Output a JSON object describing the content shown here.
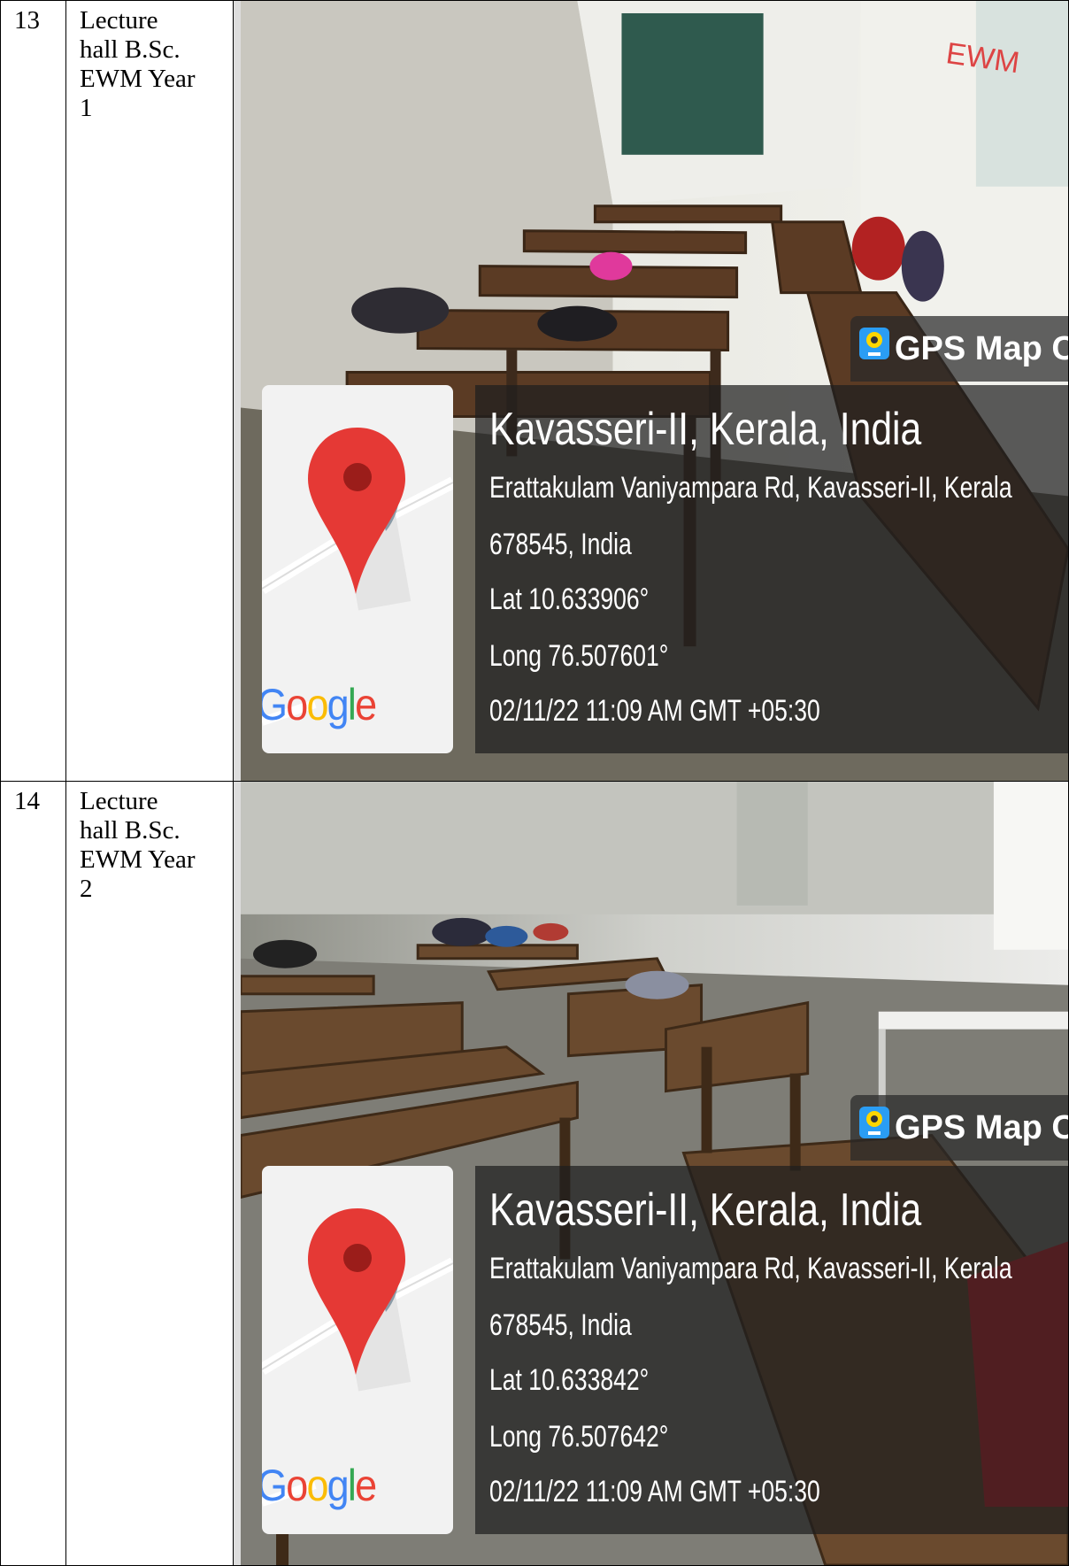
{
  "rows": [
    {
      "number": "13",
      "description_lines": [
        "Lecture",
        "hall B.Sc.",
        "EWM Year",
        "1"
      ],
      "photo": {
        "app_tag": "GPS Map Cam",
        "location_title": "Kavasseri-II, Kerala, India",
        "address_line1": "Erattakulam Vaniyampara Rd, Kavasseri-II, Kerala",
        "address_line2": "678545, India",
        "latitude": "Lat 10.633906°",
        "longitude": "Long 76.507601°",
        "timestamp": "02/11/22 11:09 AM GMT +05:30",
        "map_brand": "Google",
        "board_text": "EWM"
      }
    },
    {
      "number": "14",
      "description_lines": [
        "Lecture",
        "hall B.Sc.",
        "EWM Year",
        "2"
      ],
      "photo": {
        "app_tag": "GPS Map Came",
        "location_title": "Kavasseri-II, Kerala, India",
        "address_line1": "Erattakulam Vaniyampara Rd, Kavasseri-II, Kerala",
        "address_line2": "678545, India",
        "latitude": "Lat 10.633842°",
        "longitude": "Long 76.507642°",
        "timestamp": "02/11/22 11:09 AM GMT +05:30",
        "map_brand": "Google"
      }
    }
  ],
  "colors": {
    "google_blue": "#4285F4",
    "google_red": "#EA4335",
    "google_yellow": "#FBBC05",
    "google_green": "#34A853",
    "pin_red": "#E53935",
    "overlay": "#282828"
  }
}
